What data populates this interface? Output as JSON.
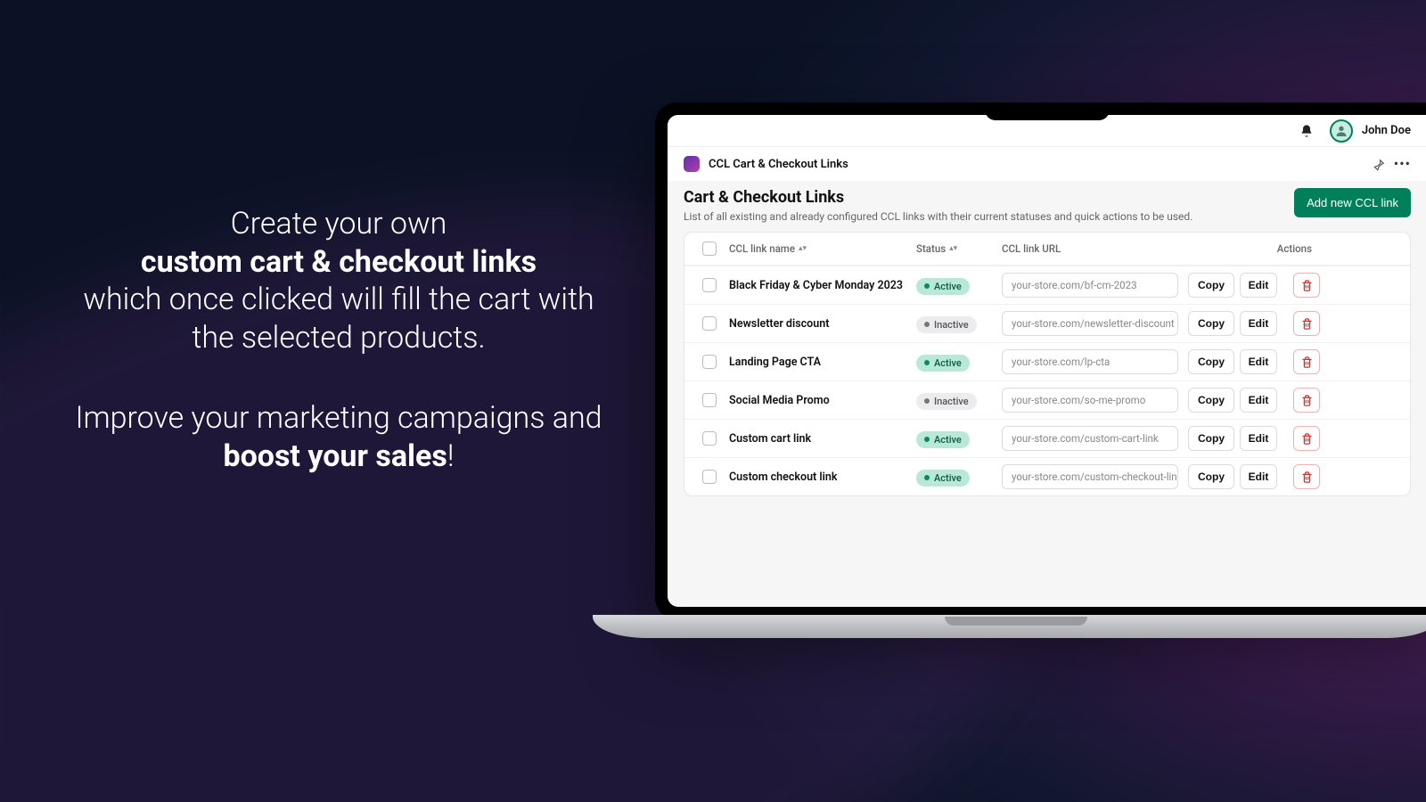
{
  "marketing": {
    "line1": "Create your own",
    "bold1": "custom cart & checkout links",
    "line2": "which once clicked will fill the cart with the selected products.",
    "line3": "Improve your marketing campaigns and ",
    "bold2": "boost your sales",
    "line4": "!"
  },
  "topbar": {
    "username": "John Doe"
  },
  "app": {
    "title": "CCL Cart & Checkout Links"
  },
  "page": {
    "title": "Cart & Checkout Links",
    "subtitle": "List of all existing and already configured CCL links with their current statuses and quick actions to be used.",
    "add_button": "Add new CCL link"
  },
  "table": {
    "headers": {
      "name": "CCL link name",
      "status": "Status",
      "url": "CCL link URL",
      "actions": "Actions"
    },
    "copy_label": "Copy",
    "edit_label": "Edit",
    "status_active": "Active",
    "status_inactive": "Inactive",
    "rows": [
      {
        "name": "Black Friday & Cyber Monday 2023",
        "status": "active",
        "url": "your-store.com/bf-cm-2023"
      },
      {
        "name": "Newsletter discount",
        "status": "inactive",
        "url": "your-store.com/newsletter-discount"
      },
      {
        "name": "Landing Page CTA",
        "status": "active",
        "url": "your-store.com/lp-cta"
      },
      {
        "name": "Social Media Promo",
        "status": "inactive",
        "url": "your-store.com/so-me-promo"
      },
      {
        "name": "Custom cart link",
        "status": "active",
        "url": "your-store.com/custom-cart-link"
      },
      {
        "name": "Custom checkout link",
        "status": "active",
        "url": "your-store.com/custom-checkout-link"
      }
    ]
  }
}
